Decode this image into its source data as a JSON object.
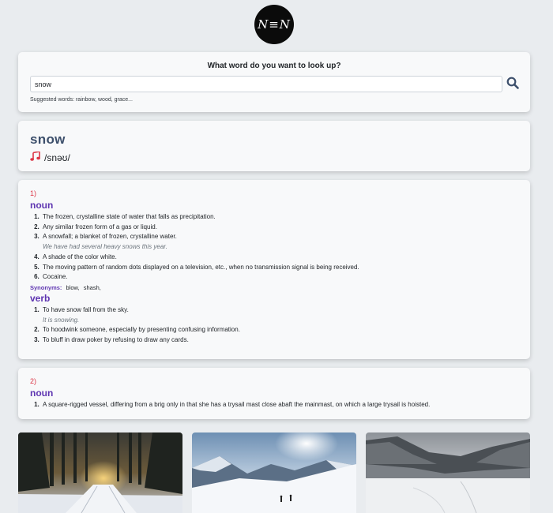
{
  "logo": {
    "text": "N≡N"
  },
  "search": {
    "title": "What word do you want to look up?",
    "value": "snow",
    "placeholder": "",
    "suggested": "Suggested words: rainbow, wood, grace..."
  },
  "word": {
    "text": "snow",
    "phonetic": "/snəʊ/"
  },
  "meanings": [
    {
      "number": "1)",
      "groups": [
        {
          "pos": "noun",
          "definitions": [
            {
              "text": "The frozen, crystalline state of water that falls as precipitation."
            },
            {
              "text": "Any similar frozen form of a gas or liquid."
            },
            {
              "text": "A snowfall; a blanket of frozen, crystalline water.",
              "example": "We have had several heavy snows this year."
            },
            {
              "text": "A shade of the color white."
            },
            {
              "text": "The moving pattern of random dots displayed on a television, etc., when no transmission signal is being received."
            },
            {
              "text": "Cocaine."
            }
          ],
          "synonyms_label": "Synonyms:",
          "synonyms": [
            "blow,",
            "shash,"
          ]
        },
        {
          "pos": "verb",
          "definitions": [
            {
              "text": "To have snow fall from the sky.",
              "example": "It is snowing."
            },
            {
              "text": "To hoodwink someone, especially by presenting confusing information."
            },
            {
              "text": "To bluff in draw poker by refusing to draw any cards."
            }
          ]
        }
      ]
    },
    {
      "number": "2)",
      "groups": [
        {
          "pos": "noun",
          "definitions": [
            {
              "text": "A square-rigged vessel, differing from a brig only in that she has a trysail mast close abaft the mainmast, on which a large trysail is hoisted."
            }
          ]
        }
      ]
    }
  ],
  "colors": {
    "accent_red": "#dc3545",
    "pos_purple": "#5e35b1",
    "word_blue": "#3c4f6b",
    "search_icon": "#3c4f6b"
  },
  "icons": [
    "search-icon",
    "music-note-icon"
  ],
  "images": [
    "snowy-forest-road-image",
    "snowy-mountain-skiers-image",
    "snowy-valley-forest-image"
  ]
}
